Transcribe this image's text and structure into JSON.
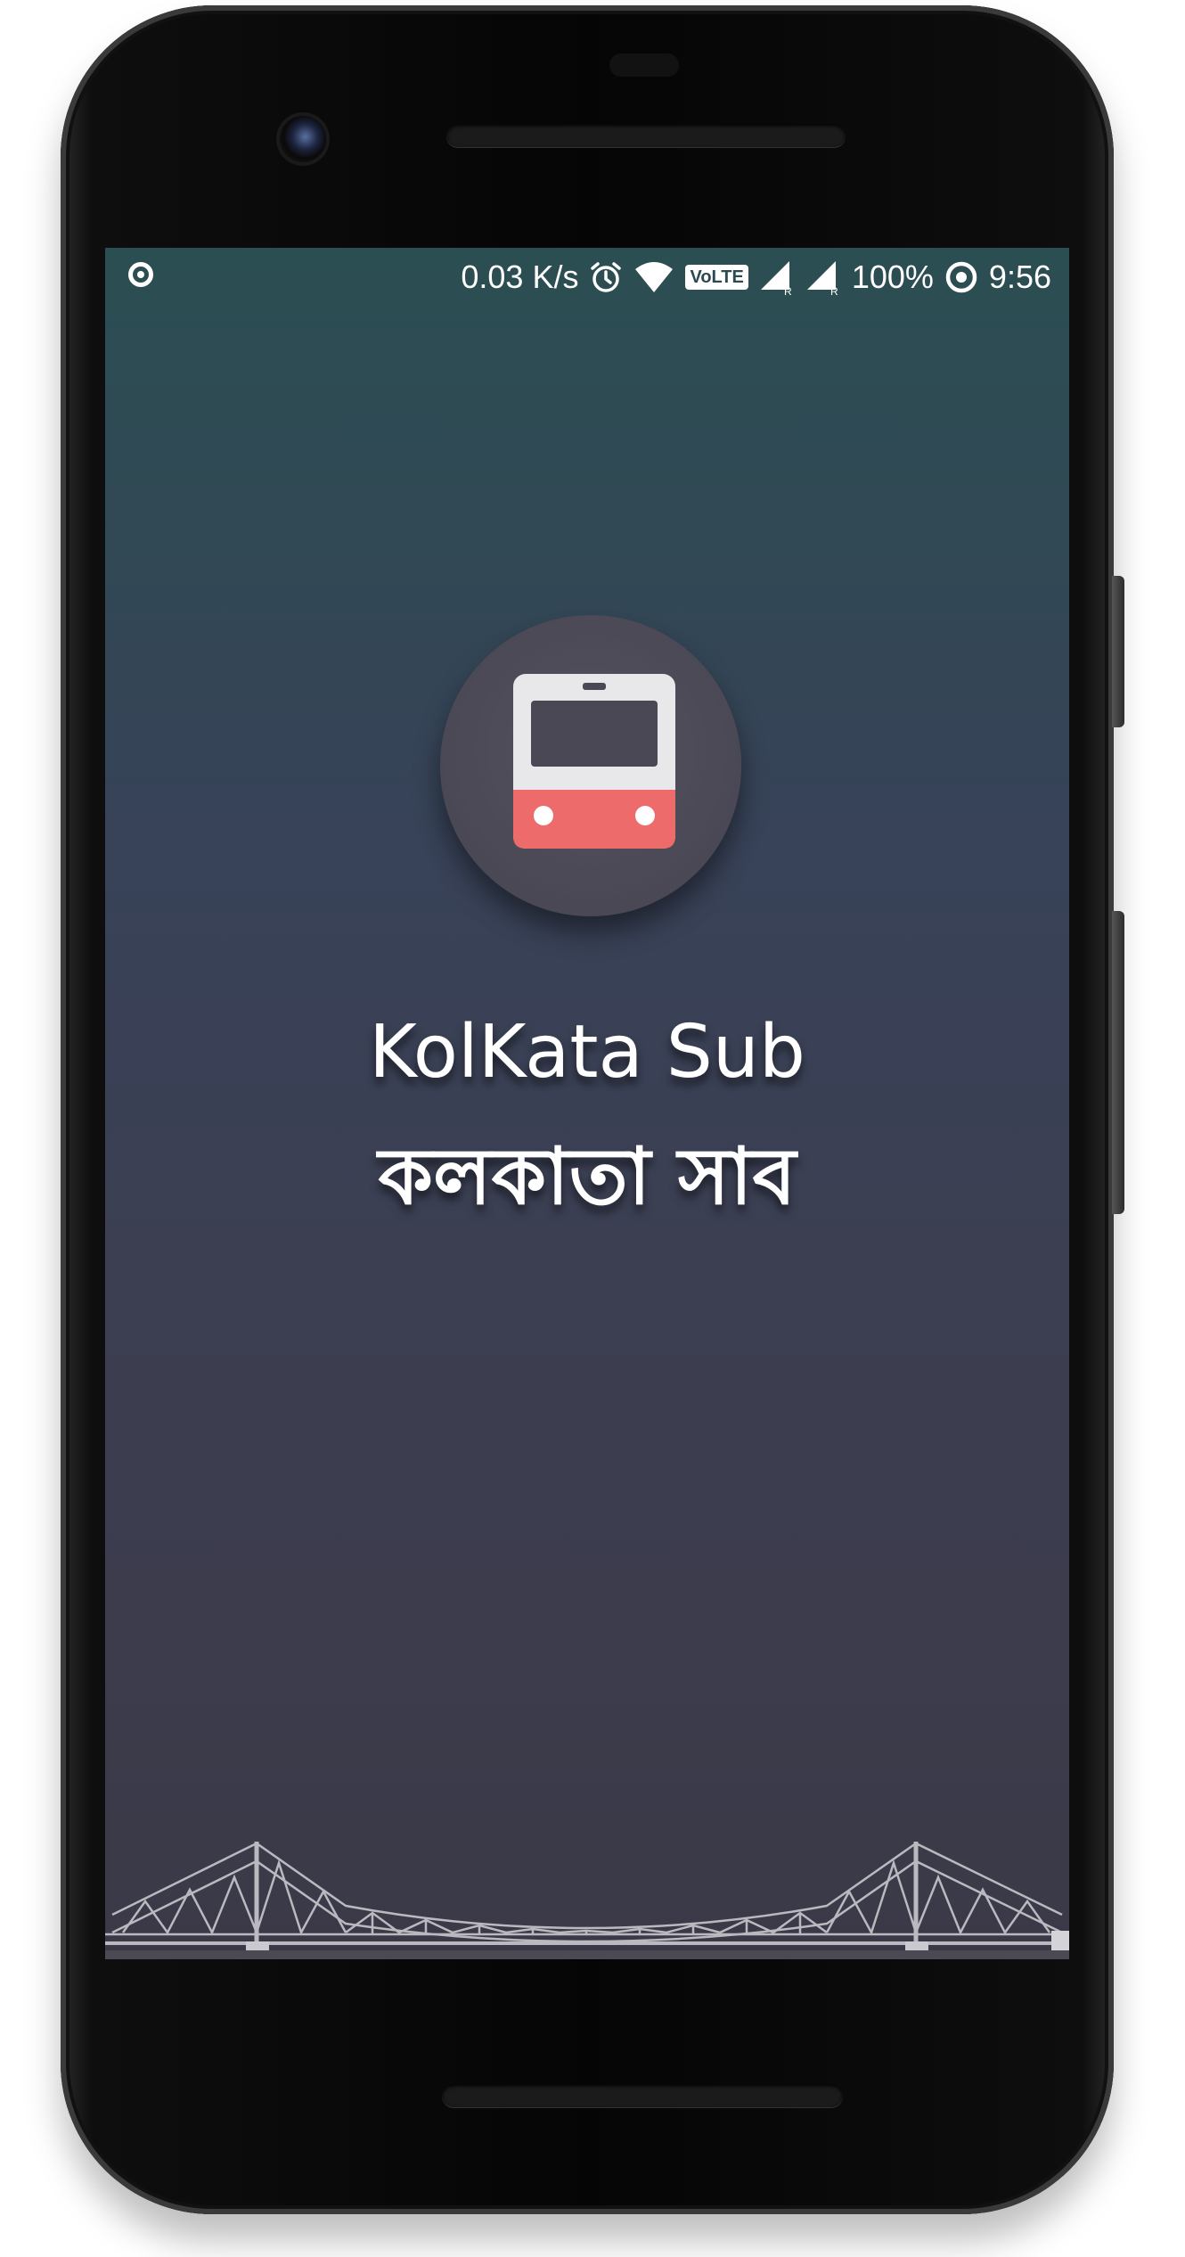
{
  "status_bar": {
    "network_speed": "0.03 K/s",
    "volte_label": "VoLTE",
    "battery": "100%",
    "time": "9:56",
    "icons": [
      "record-icon",
      "alarm-icon",
      "wifi-icon",
      "volte-icon",
      "signal-icon",
      "signal-icon",
      "data-saver-icon"
    ]
  },
  "splash": {
    "app_logo_icon": "train-icon",
    "title_en": "KolKata Sub",
    "title_bn": "কলকাতা সাব",
    "footer_graphic": "howrah-bridge-illustration"
  },
  "colors": {
    "train_body": "#e8e8ea",
    "train_front": "#ee6b6b",
    "logo_circle": "#4a4855",
    "background_top": "#2b4e52",
    "background_bottom": "#3b3947"
  }
}
